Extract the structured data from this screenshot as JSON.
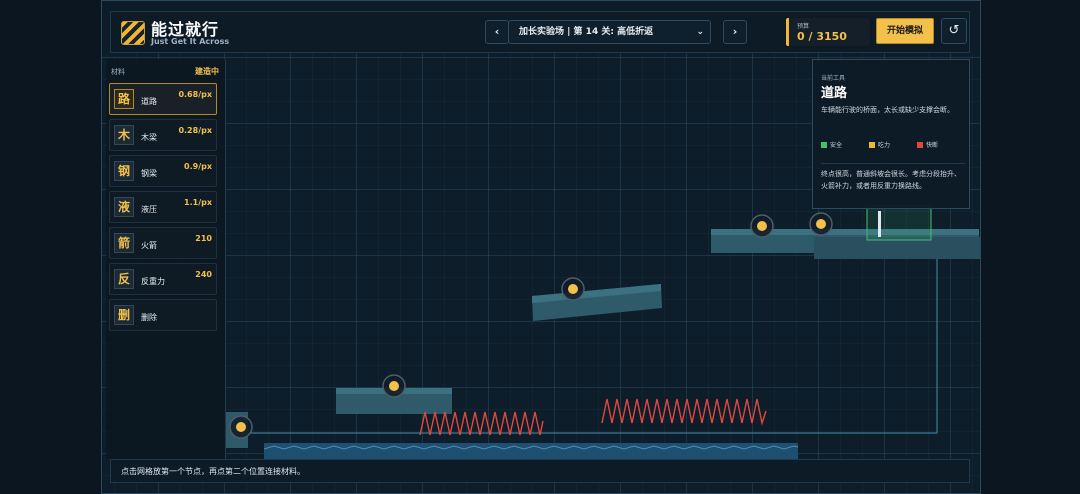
{
  "header": {
    "title": "能过就行",
    "subtitle": "Just Get It Across",
    "prev_icon": "chevron-left-icon",
    "next_icon": "chevron-right-icon",
    "level": "加长实验场 | 第 14 关: 高低折返",
    "budget_label": "预算",
    "budget_value": "0 / 3150",
    "start_label": "开始模拟",
    "reset_icon": "refresh-icon"
  },
  "palette": {
    "heading": "材料",
    "state": "建造中",
    "tools": [
      {
        "glyph": "路",
        "name": "道路",
        "cost": "0.68/px",
        "active": true
      },
      {
        "glyph": "木",
        "name": "木梁",
        "cost": "0.28/px"
      },
      {
        "glyph": "钢",
        "name": "钢梁",
        "cost": "0.9/px"
      },
      {
        "glyph": "液",
        "name": "液压",
        "cost": "1.1/px"
      },
      {
        "glyph": "箭",
        "name": "火箭",
        "cost": "210"
      },
      {
        "glyph": "反",
        "name": "反重力",
        "cost": "240"
      },
      {
        "glyph": "删",
        "name": "删除",
        "cost": ""
      }
    ]
  },
  "info": {
    "kicker": "当前工具",
    "title": "道路",
    "desc": "车辆能行驶的桥面，太长或缺少支撑会断。",
    "legend": [
      {
        "label": "安全",
        "color": "#3ec46d"
      },
      {
        "label": "吃力",
        "color": "#f2b632"
      },
      {
        "label": "快断",
        "color": "#e0483e"
      }
    ],
    "desc2": "终点很高，普通斜坡会很长。考虑分段抬升、火箭补力，或者用反重力换路线。"
  },
  "footer": {
    "hint": "点击网格放第一个节点，再点第二个位置连接材料。"
  },
  "colors": {
    "accent": "#f2c04b",
    "platform": "#2f5a6a",
    "spike": "#e0483e",
    "water": "#1f5f86",
    "goal": "#3ec46d"
  }
}
